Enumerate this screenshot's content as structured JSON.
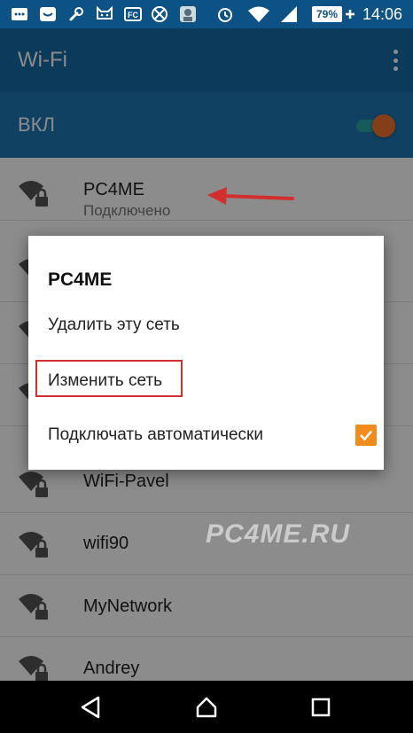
{
  "status_bar": {
    "time": "14:06",
    "battery": "79%",
    "icons": [
      "message-icon",
      "chat-icon",
      "wrench-icon",
      "cat-icon",
      "fc-icon",
      "hazard-icon",
      "app-icon",
      "alarm-icon",
      "wifi-signal-icon",
      "cell-signal-icon",
      "battery-icon"
    ]
  },
  "app_bar": {
    "title": "Wi-Fi"
  },
  "wifi_switch": {
    "label": "ВКЛ",
    "state": "on"
  },
  "networks": [
    {
      "name": "PC4ME",
      "status": "Подключено"
    },
    {
      "name": "",
      "status": ""
    },
    {
      "name": "",
      "status": ""
    },
    {
      "name": "",
      "status": ""
    },
    {
      "name": "WiFi-Pavel",
      "status": ""
    },
    {
      "name": "wifi90",
      "status": ""
    },
    {
      "name": "MyNetwork",
      "status": ""
    },
    {
      "name": "Andrey",
      "status": ""
    }
  ],
  "dialog": {
    "title": "PC4ME",
    "forget_label": "Удалить эту сеть",
    "modify_label": "Изменить сеть",
    "auto_connect_label": "Подключать автоматически",
    "auto_connect_checked": true
  },
  "watermark": "PC4ME.RU",
  "colors": {
    "status_bar": "#0d5284",
    "app_bar": "#166aa4",
    "switch_bar": "#1e76b3",
    "accent": "#f28c1c",
    "annotation": "#d32f2f"
  },
  "navigation": [
    "back-icon",
    "home-icon",
    "recents-icon"
  ]
}
